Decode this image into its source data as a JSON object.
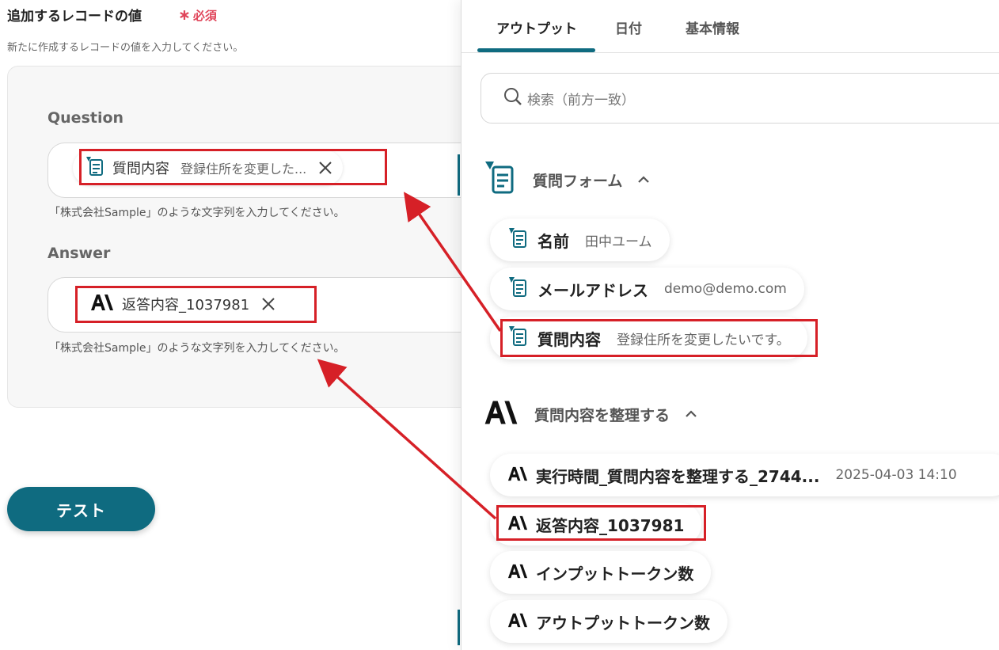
{
  "form": {
    "title": "追加するレコードの値",
    "required_label": "必須",
    "required_mark": "∗",
    "description": "新たに作成するレコードの値を入力してください。",
    "fields": [
      {
        "label": "Question",
        "chip_name": "質問内容",
        "chip_value": "登録住所を変更した...",
        "hint": "「株式会社Sample」のような文字列を入力してください。"
      },
      {
        "label": "Answer",
        "chip_name": "返答内容_1037981",
        "hint": "「株式会社Sample」のような文字列を入力してください。"
      }
    ],
    "test_button": "テスト"
  },
  "panel": {
    "tabs": [
      "アウトプット",
      "日付",
      "基本情報"
    ],
    "active_tab": "アウトプット",
    "search_placeholder": "検索（前方一致）",
    "groups": [
      {
        "title": "質問フォーム",
        "icon": "form-icon",
        "items": [
          {
            "name": "名前",
            "value": "田中ユーム"
          },
          {
            "name": "メールアドレス",
            "value": "demo@demo.com"
          },
          {
            "name": "質問内容",
            "value": "登録住所を変更したいです。"
          }
        ]
      },
      {
        "title": "質問内容を整理する",
        "icon": "anthropic-icon",
        "items": [
          {
            "name": "実行時間_質問内容を整理する_2744...",
            "value": "2025-04-03 14:10"
          },
          {
            "name": "返答内容_1037981",
            "value": ""
          },
          {
            "name": "インプットトークン数",
            "value": ""
          },
          {
            "name": "アウトプットトークン数",
            "value": ""
          }
        ]
      }
    ]
  },
  "colors": {
    "accent": "#0f6b80",
    "required": "#e0455a",
    "highlight": "#d62027"
  }
}
